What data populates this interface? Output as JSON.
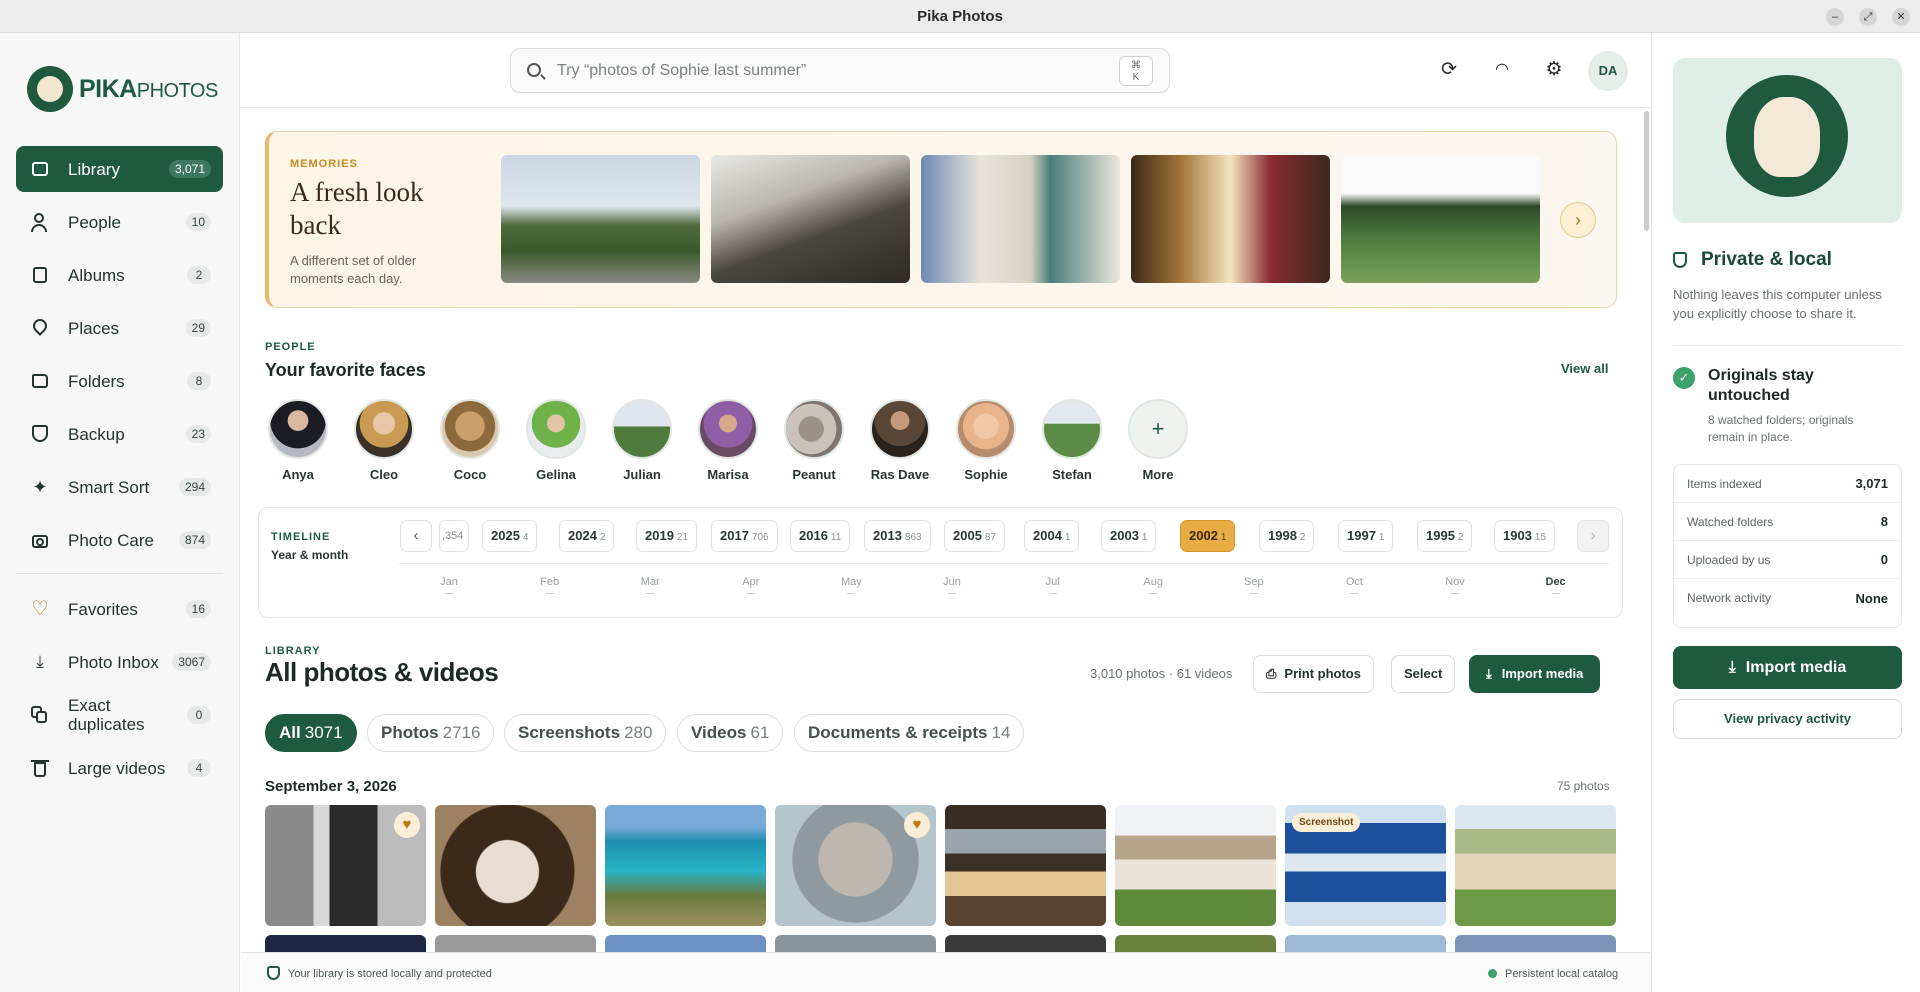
{
  "window": {
    "title": "Pika Photos"
  },
  "brand": {
    "logo_main": "PIKA",
    "logo_sub": "PHOTOS"
  },
  "sidebar": {
    "items": [
      {
        "label": "Library",
        "count": "3,071"
      },
      {
        "label": "People",
        "count": "10"
      },
      {
        "label": "Albums",
        "count": "2"
      },
      {
        "label": "Places",
        "count": "29"
      },
      {
        "label": "Folders",
        "count": "8"
      },
      {
        "label": "Backup",
        "count": "23"
      },
      {
        "label": "Smart Sort",
        "count": "294"
      },
      {
        "label": "Photo Care",
        "count": "874"
      }
    ],
    "secondary": [
      {
        "label": "Favorites",
        "count": "16"
      },
      {
        "label": "Photo Inbox",
        "count": "3067"
      },
      {
        "label": "Exact duplicates",
        "count": "0"
      },
      {
        "label": "Large videos",
        "count": "4"
      }
    ]
  },
  "search": {
    "placeholder": "Try “photos of Sophie last summer”",
    "kbd_top": "⌘",
    "kbd_bottom": "K"
  },
  "header": {
    "avatar": "DA"
  },
  "memories": {
    "kicker": "MEMORIES",
    "title": "A fresh look back",
    "subtitle": "A different set of older moments each day."
  },
  "people": {
    "kicker": "PEOPLE",
    "title": "Your favorite faces",
    "view_all": "View all",
    "faces": [
      "Anya",
      "Cleo",
      "Coco",
      "Gelina",
      "Julian",
      "Marisa",
      "Peanut",
      "Ras Dave",
      "Sophie",
      "Stefan"
    ],
    "more": "More",
    "more_icon": "+"
  },
  "timeline": {
    "kicker": "TIMELINE",
    "subtitle": "Year & month",
    "partial": ",354",
    "years": [
      {
        "year": "2025",
        "count": "4"
      },
      {
        "year": "2024",
        "count": "2"
      },
      {
        "year": "2019",
        "count": "21"
      },
      {
        "year": "2017",
        "count": "706"
      },
      {
        "year": "2016",
        "count": "11"
      },
      {
        "year": "2013",
        "count": "863"
      },
      {
        "year": "2005",
        "count": "87"
      },
      {
        "year": "2004",
        "count": "1"
      },
      {
        "year": "2003",
        "count": "1"
      },
      {
        "year": "2002",
        "count": "1"
      },
      {
        "year": "1998",
        "count": "2"
      },
      {
        "year": "1997",
        "count": "1"
      },
      {
        "year": "1995",
        "count": "2"
      },
      {
        "year": "1903",
        "count": "15"
      }
    ],
    "selected_year": "2002",
    "months": [
      "Jan",
      "Feb",
      "Mar",
      "Apr",
      "May",
      "Jun",
      "Jul",
      "Aug",
      "Sep",
      "Oct",
      "Nov",
      "Dec"
    ]
  },
  "library": {
    "kicker": "LIBRARY",
    "title": "All photos & videos",
    "count_text": "3,010 photos · 61 videos",
    "print_label": "Print photos",
    "select_label": "Select",
    "import_label": "Import media",
    "filters": [
      {
        "label": "All",
        "count": "3071"
      },
      {
        "label": "Photos",
        "count": "2716"
      },
      {
        "label": "Screenshots",
        "count": "280"
      },
      {
        "label": "Videos",
        "count": "61"
      },
      {
        "label": "Documents & receipts",
        "count": "14"
      }
    ],
    "group_date": "September 3, 2026",
    "group_count": "75 photos",
    "screenshot_badge": "Screenshot",
    "heart_icon": "♥"
  },
  "status": {
    "left": "Your library is stored locally and protected",
    "right": "Persistent local catalog"
  },
  "privacy": {
    "title": "Private & local",
    "desc": "Nothing leaves this computer unless you explicitly choose to share it.",
    "originals_title": "Originals stay untouched",
    "originals_sub": "8 watched folders; originals remain in place.",
    "check_icon": "✓",
    "stats": [
      {
        "label": "Items indexed",
        "value": "3,071"
      },
      {
        "label": "Watched folders",
        "value": "8"
      },
      {
        "label": "Uploaded by us",
        "value": "0"
      },
      {
        "label": "Network activity",
        "value": "None"
      }
    ],
    "import_label": "Import media",
    "activity_label": "View privacy activity"
  },
  "colors": {
    "brand_green": "#1e5a40",
    "accent_gold": "#e9ac45",
    "success": "#3aa26a"
  }
}
